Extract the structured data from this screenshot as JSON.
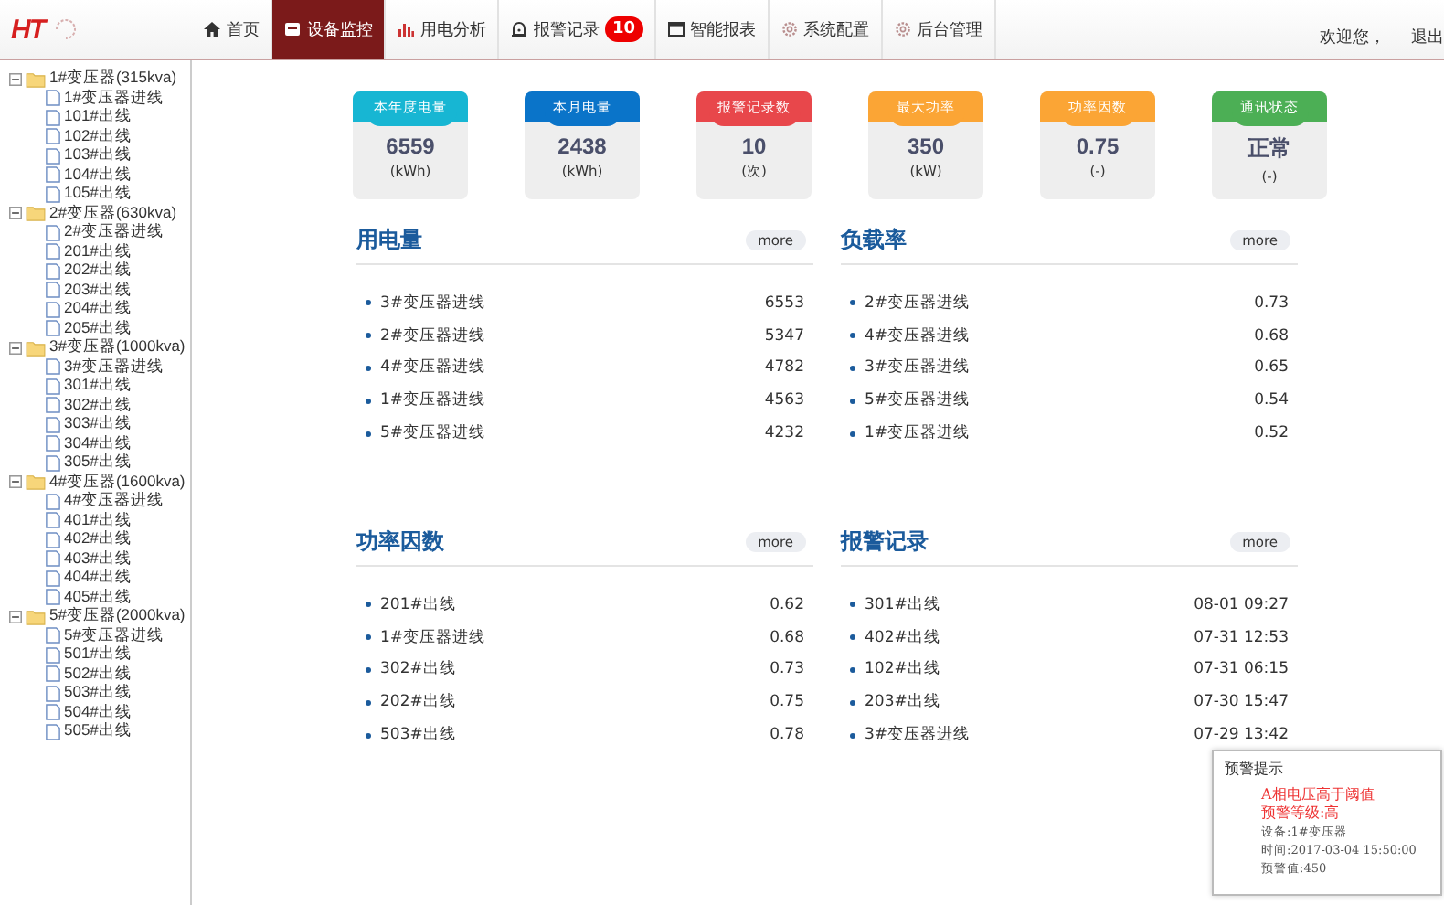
{
  "header": {
    "logo": "HT",
    "nav": [
      {
        "label": "首页",
        "selected": false
      },
      {
        "label": "设备监控",
        "selected": true
      },
      {
        "label": "用电分析",
        "selected": false
      },
      {
        "label": "报警记录",
        "selected": false,
        "badge": "10"
      },
      {
        "label": "智能报表",
        "selected": false
      },
      {
        "label": "系统配置",
        "selected": false
      },
      {
        "label": "后台管理",
        "selected": false
      }
    ],
    "welcome": "欢迎您，",
    "logout": "退出"
  },
  "tree": [
    {
      "label": "1#变压器(315kva)",
      "expanded": true,
      "children": [
        {
          "label": "1#变压器进线"
        },
        {
          "label": "101#出线"
        },
        {
          "label": "102#出线"
        },
        {
          "label": "103#出线"
        },
        {
          "label": "104#出线"
        },
        {
          "label": "105#出线"
        }
      ]
    },
    {
      "label": "2#变压器(630kva)",
      "expanded": true,
      "children": [
        {
          "label": "2#变压器进线"
        },
        {
          "label": "201#出线"
        },
        {
          "label": "202#出线"
        },
        {
          "label": "203#出线"
        },
        {
          "label": "204#出线"
        },
        {
          "label": "205#出线"
        }
      ]
    },
    {
      "label": "3#变压器(1000kva)",
      "expanded": true,
      "children": [
        {
          "label": "3#变压器进线"
        },
        {
          "label": "301#出线"
        },
        {
          "label": "302#出线"
        },
        {
          "label": "303#出线"
        },
        {
          "label": "304#出线"
        },
        {
          "label": "305#出线"
        }
      ]
    },
    {
      "label": "4#变压器(1600kva)",
      "expanded": true,
      "children": [
        {
          "label": "4#变压器进线"
        },
        {
          "label": "401#出线"
        },
        {
          "label": "402#出线"
        },
        {
          "label": "403#出线"
        },
        {
          "label": "404#出线"
        },
        {
          "label": "405#出线"
        }
      ]
    },
    {
      "label": "5#变压器(2000kva)",
      "expanded": true,
      "children": [
        {
          "label": "5#变压器进线"
        },
        {
          "label": "501#出线"
        },
        {
          "label": "502#出线"
        },
        {
          "label": "503#出线"
        },
        {
          "label": "504#出线"
        },
        {
          "label": "505#出线"
        }
      ]
    }
  ],
  "stat_cards": [
    {
      "title": "本年度电量",
      "value": "6559",
      "unit": "(kWh)",
      "color": "#17b6d3"
    },
    {
      "title": "本月电量",
      "value": "2438",
      "unit": "(kWh)",
      "color": "#0a74c9"
    },
    {
      "title": "报警记录数",
      "value": "10",
      "unit": "(次)",
      "color": "#e8474b"
    },
    {
      "title": "最大功率",
      "value": "350",
      "unit": "(kW)",
      "color": "#fba535"
    },
    {
      "title": "功率因数",
      "value": "0.75",
      "unit": "(-)",
      "color": "#fba535"
    },
    {
      "title": "通讯状态",
      "value": "正常",
      "unit": "(-)",
      "color": "#4caf55"
    }
  ],
  "panels": [
    {
      "title": "用电量",
      "more": "more",
      "rows": [
        {
          "name": "3#变压器进线",
          "value": "6553"
        },
        {
          "name": "2#变压器进线",
          "value": "5347"
        },
        {
          "name": "4#变压器进线",
          "value": "4782"
        },
        {
          "name": "1#变压器进线",
          "value": "4563"
        },
        {
          "name": "5#变压器进线",
          "value": "4232"
        }
      ]
    },
    {
      "title": "负载率",
      "more": "more",
      "rows": [
        {
          "name": "2#变压器进线",
          "value": "0.73"
        },
        {
          "name": "4#变压器进线",
          "value": "0.68"
        },
        {
          "name": "3#变压器进线",
          "value": "0.65"
        },
        {
          "name": "5#变压器进线",
          "value": "0.54"
        },
        {
          "name": "1#变压器进线",
          "value": "0.52"
        }
      ]
    },
    {
      "title": "功率因数",
      "more": "more",
      "rows": [
        {
          "name": "201#出线",
          "value": "0.62"
        },
        {
          "name": "1#变压器进线",
          "value": "0.68"
        },
        {
          "name": "302#出线",
          "value": "0.73"
        },
        {
          "name": "202#出线",
          "value": "0.75"
        },
        {
          "name": "503#出线",
          "value": "0.78"
        }
      ]
    },
    {
      "title": "报警记录",
      "more": "more",
      "rows": [
        {
          "name": "301#出线",
          "value": "08-01 09:27"
        },
        {
          "name": "402#出线",
          "value": "07-31 12:53"
        },
        {
          "name": "102#出线",
          "value": "07-31 06:15"
        },
        {
          "name": "203#出线",
          "value": "07-30 15:47"
        },
        {
          "name": "3#变压器进线",
          "value": "07-29 13:42"
        }
      ]
    }
  ],
  "popup": {
    "title": "预警提示",
    "lines": [
      {
        "kind": "alert",
        "text": "A相电压高于阈值"
      },
      {
        "kind": "alert",
        "text": "预警等级:高"
      },
      {
        "kind": "info",
        "text": "设备:1#变压器"
      },
      {
        "kind": "info",
        "text": "时间:2017-03-04 15:50:00"
      },
      {
        "kind": "info",
        "text": "预警值:450"
      }
    ]
  }
}
